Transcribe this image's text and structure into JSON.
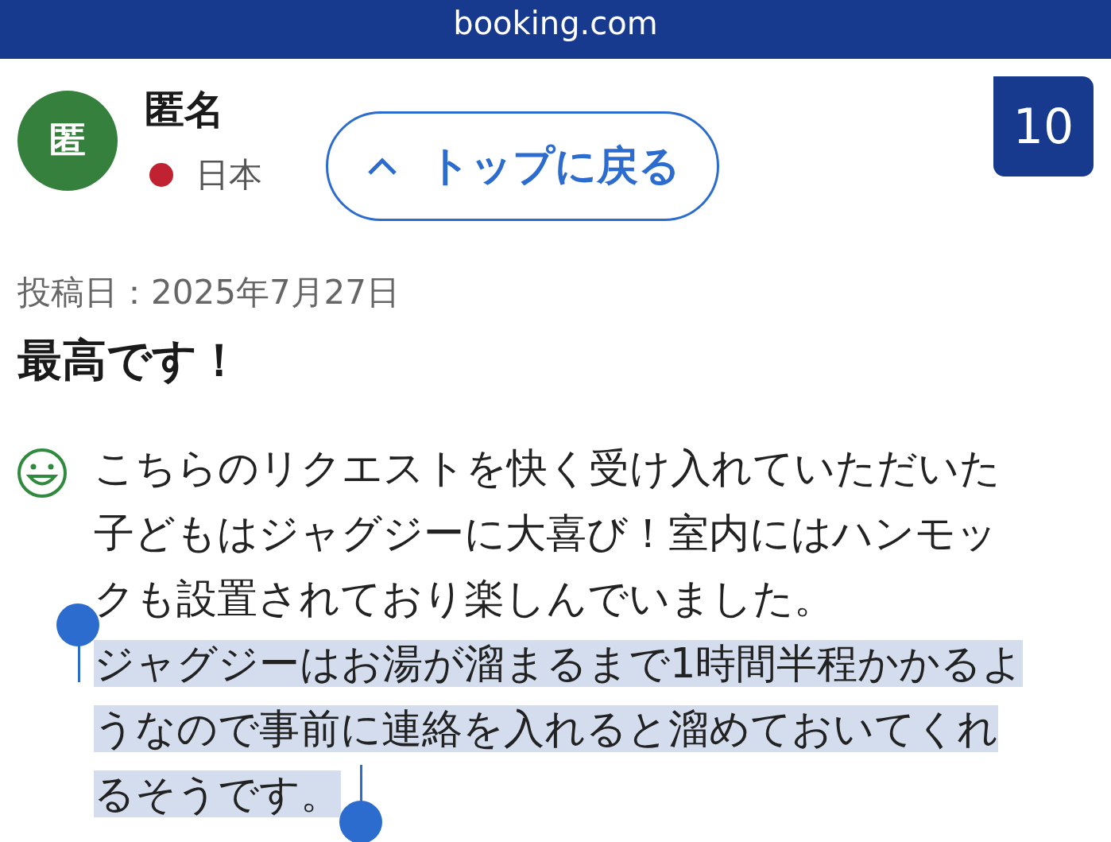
{
  "header": {
    "site": "booking.com"
  },
  "reviewer": {
    "initial": "匿",
    "name": "匿名",
    "country": "日本"
  },
  "back_to_top": {
    "label": "トップに戻る"
  },
  "score": "10",
  "review": {
    "date": "投稿日：2025年7月27日",
    "title": "最高です！",
    "lines": [
      {
        "text": "こちらのリクエストを快く受け入れていただいた",
        "selected": false
      },
      {
        "text": "子どもはジャグジーに大喜び！室内にはハンモッ",
        "selected": false
      },
      {
        "text": "クも設置されており楽しんでいました。",
        "selected": false
      },
      {
        "text": "ジャグジーはお湯が溜まるまで1時間半程かかるよ",
        "selected": true
      },
      {
        "text": "うなので事前に連絡を入れると溜めておいてくれ",
        "selected": true
      },
      {
        "text": "るそうです。",
        "selected": true
      }
    ]
  }
}
